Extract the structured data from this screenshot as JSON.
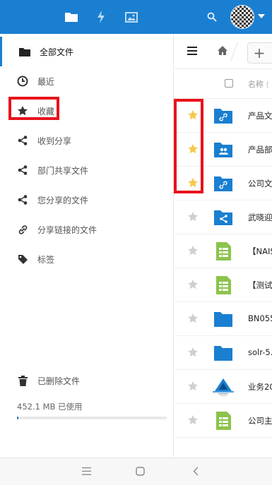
{
  "colors": {
    "accent": "#1a7fd1",
    "highlight": "#e8121b",
    "star_on": "#f5c84c",
    "star_off": "#cfcfcf",
    "sheet_green": "#8cc34b"
  },
  "topbar": {
    "tabs": [
      {
        "icon": "folder-icon"
      },
      {
        "icon": "lightning-icon"
      },
      {
        "icon": "image-icon"
      }
    ],
    "search_icon": "search-icon",
    "avatar": "avatar"
  },
  "sidebar": {
    "items": [
      {
        "label": "全部文件",
        "icon": "folder-icon",
        "active": true
      },
      {
        "label": "最近",
        "icon": "clock-icon"
      },
      {
        "label": "收藏",
        "icon": "star-icon"
      },
      {
        "label": "收到分享",
        "icon": "share-icon"
      },
      {
        "label": "部门共享文件",
        "icon": "share-icon"
      },
      {
        "label": "您分享的文件",
        "icon": "share-icon"
      },
      {
        "label": "分享链接的文件",
        "icon": "link-icon"
      },
      {
        "label": "标签",
        "icon": "tag-icon"
      }
    ],
    "deleted_label": "已删除文件",
    "quota_text": "452.1 MB 已使用",
    "quota_fraction": 0.01
  },
  "files": {
    "header_name": "名称",
    "rows": [
      {
        "name": "产品文",
        "type": "folder-link",
        "starred": true
      },
      {
        "name": "产品部",
        "type": "folder-group",
        "starred": true
      },
      {
        "name": "公司文",
        "type": "folder-link",
        "starred": true
      },
      {
        "name": "武晓迎",
        "type": "folder-share",
        "starred": false
      },
      {
        "name": "【NAIS",
        "type": "sheet",
        "starred": false
      },
      {
        "name": "【测试",
        "type": "sheet",
        "starred": false
      },
      {
        "name": "BN055",
        "type": "folder",
        "starred": false
      },
      {
        "name": "solr-5.",
        "type": "folder",
        "starred": false
      },
      {
        "name": "业务20",
        "type": "logo",
        "starred": false
      },
      {
        "name": "公司主",
        "type": "sheet",
        "starred": false
      }
    ]
  }
}
